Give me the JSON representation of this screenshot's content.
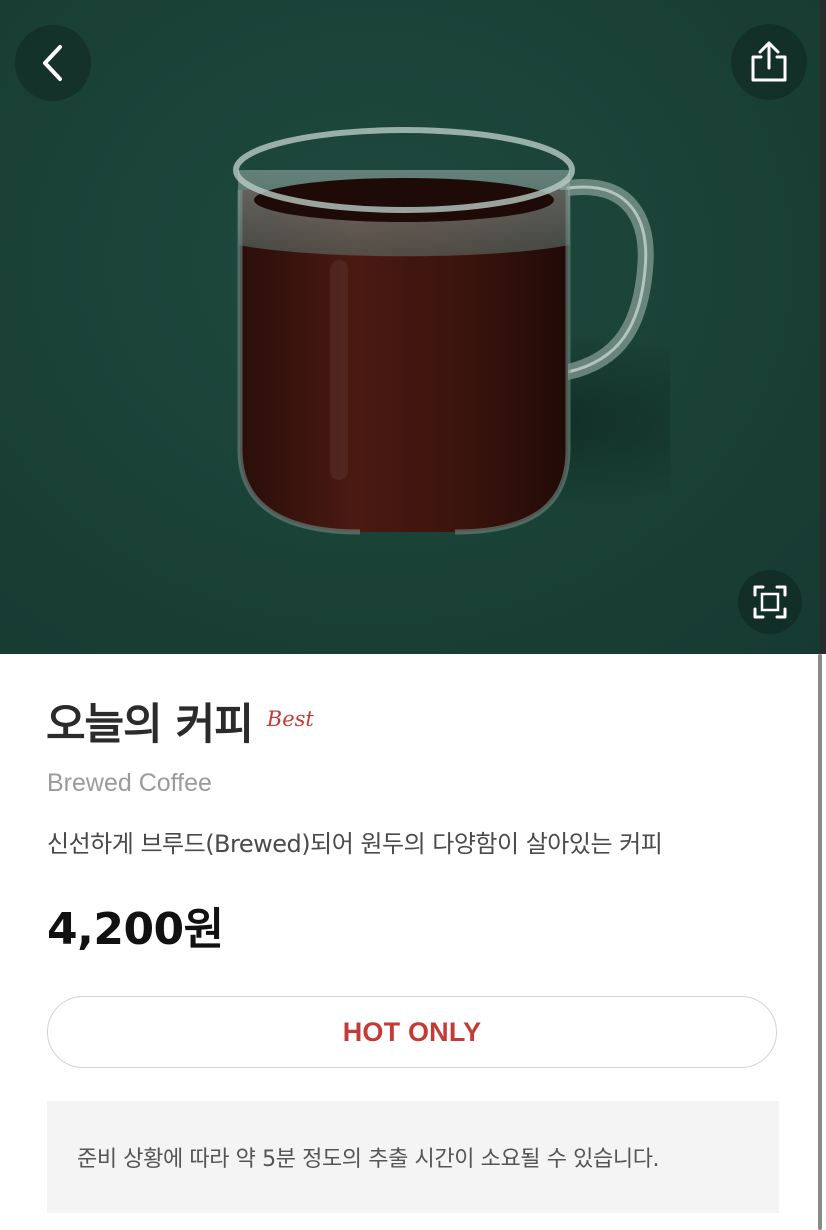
{
  "header": {
    "back_icon": "chevron-left-icon",
    "share_icon": "share-icon",
    "zoom_icon": "expand-frame-icon"
  },
  "hero": {
    "image_subject": "mug-icon",
    "background_color": "#1a4136"
  },
  "product": {
    "name": "오늘의 커피",
    "badge": "Best",
    "english_name": "Brewed Coffee",
    "description": "신선하게 브루드(Brewed)되어 원두의 다양함이 살아있는 커피",
    "price": "4,200원"
  },
  "option": {
    "label": "HOT ONLY"
  },
  "notice": {
    "text": "준비 상황에 따라 약 5분 정도의 추출 시간이 소요될 수 있습니다."
  },
  "colors": {
    "accent": "#c43a36",
    "hero_bg": "#1a4136",
    "text_primary": "#2b2b2b",
    "text_secondary": "#9b9b9b"
  }
}
